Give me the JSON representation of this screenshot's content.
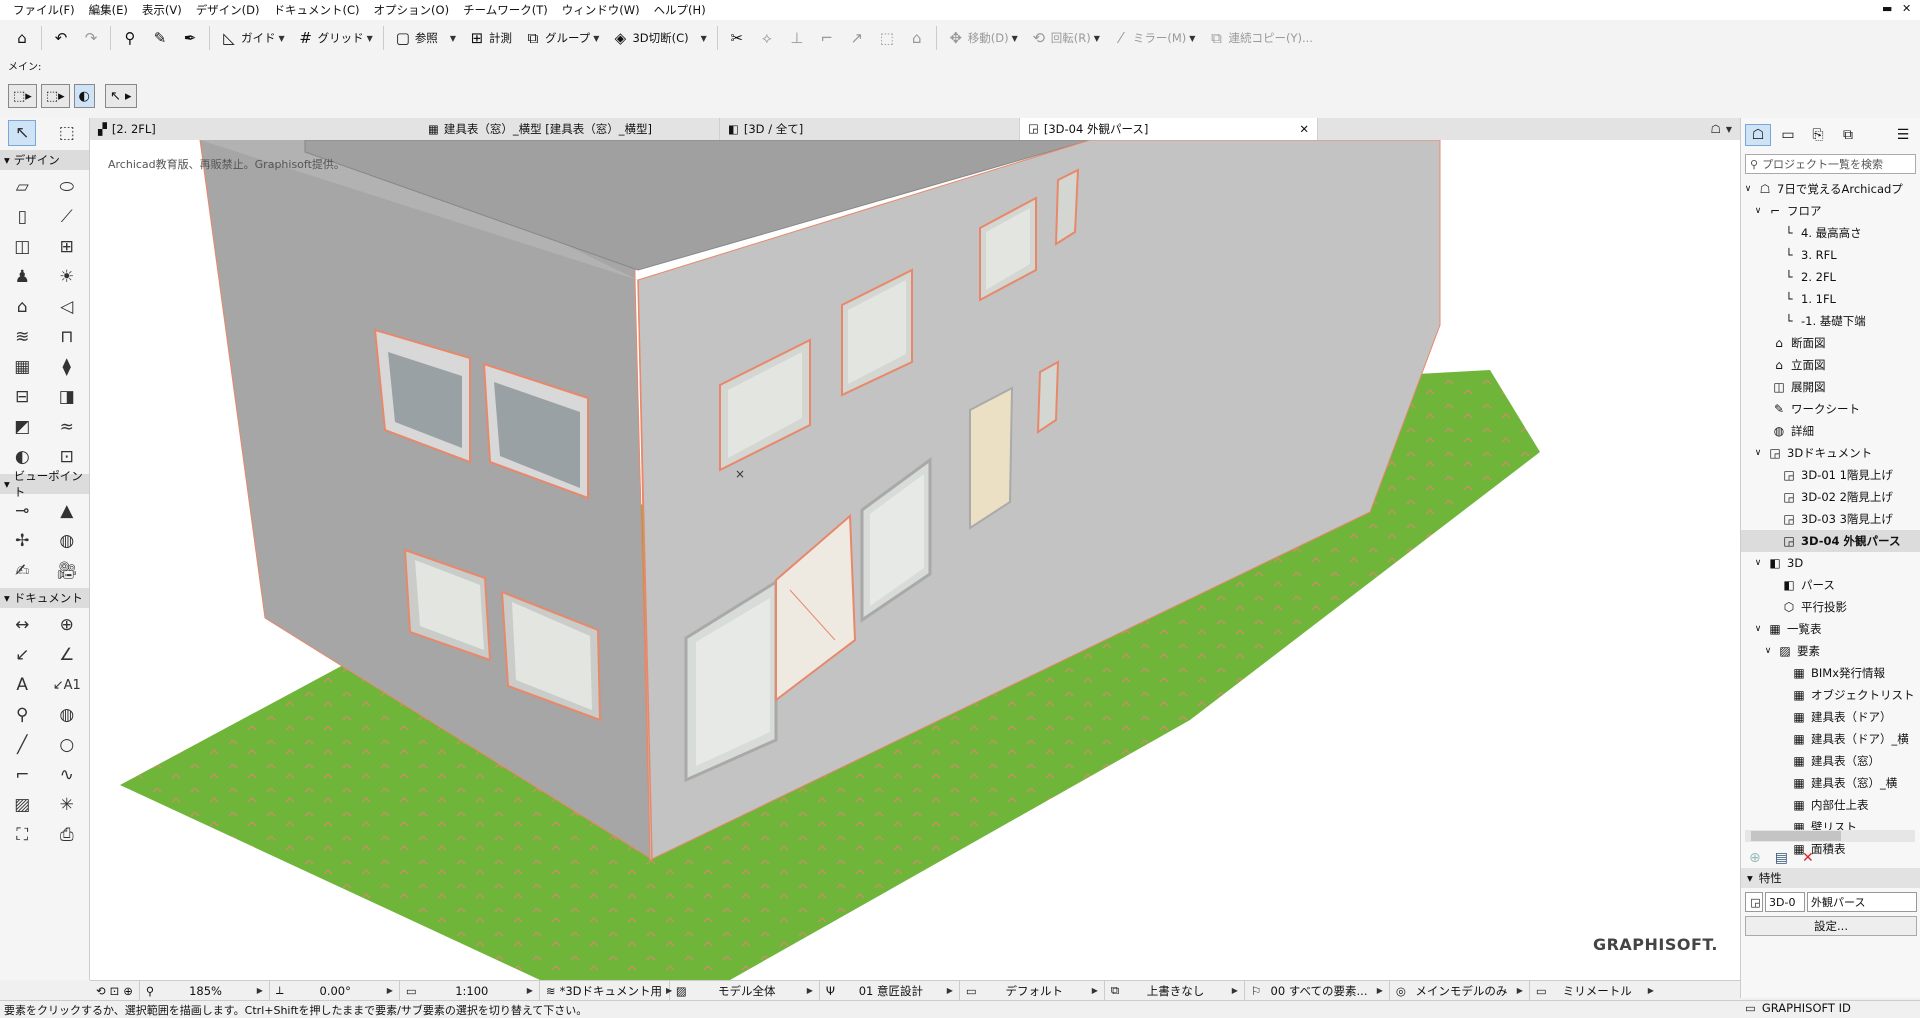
{
  "menu": [
    "ファイル(F)",
    "編集(E)",
    "表示(V)",
    "デザイン(D)",
    "ドキュメント(C)",
    "オプション(O)",
    "チームワーク(T)",
    "ウィンドウ(W)",
    "ヘルプ(H)"
  ],
  "toolbar": {
    "guide": "ガイド",
    "grid": "グリッド",
    "reference": "参照",
    "measure": "計測",
    "group": "グループ",
    "cut3d": "3D切断(C)",
    "move": "移動(D)",
    "rotate": "回転(R)",
    "mirror": "ミラー(M)",
    "multiply": "連続コピー(Y)..."
  },
  "sub": {
    "main_label": "メイン:"
  },
  "tabs": [
    {
      "label": "[2. 2FL]"
    },
    {
      "label": "建具表（窓）_横型 [建具表（窓）_横型]"
    },
    {
      "label": "[3D / 全て]"
    },
    {
      "label": "[3D-04 外観パース]"
    }
  ],
  "left": {
    "design": "デザイン",
    "viewpoint": "ビューポイント",
    "document": "ドキュメント"
  },
  "viewport": {
    "watermark": "Archicad教育版、再販禁止。Graphisoft提供。",
    "brand": "GRAPHISOFT."
  },
  "navigator": {
    "search_placeholder": "プロジェクト一覧を検索",
    "items": [
      {
        "label": "7日で覚えるArchicadプ",
        "icon": "project-icon"
      },
      {
        "label": "フロア",
        "icon": "folder-icon"
      },
      {
        "label": "4. 最高高さ",
        "icon": "story-icon"
      },
      {
        "label": "3. RFL",
        "icon": "story-icon"
      },
      {
        "label": "2. 2FL",
        "icon": "story-icon"
      },
      {
        "label": "1. 1FL",
        "icon": "story-icon"
      },
      {
        "label": "-1. 基礎下端",
        "icon": "story-icon"
      },
      {
        "label": "断面図",
        "icon": "section-icon"
      },
      {
        "label": "立面図",
        "icon": "elevation-icon"
      },
      {
        "label": "展開図",
        "icon": "interior-elevation-icon"
      },
      {
        "label": "ワークシート",
        "icon": "worksheet-icon"
      },
      {
        "label": "詳細",
        "icon": "detail-icon"
      },
      {
        "label": "3Dドキュメント",
        "icon": "3d-document-icon"
      },
      {
        "label": "3D-01 1階見上げ",
        "icon": "3d-document-icon"
      },
      {
        "label": "3D-02 2階見上げ",
        "icon": "3d-document-icon"
      },
      {
        "label": "3D-03 3階見上げ",
        "icon": "3d-document-icon"
      },
      {
        "label": "3D-04 外観パース",
        "icon": "3d-document-icon"
      },
      {
        "label": "3D",
        "icon": "3d-icon"
      },
      {
        "label": "パース",
        "icon": "perspective-icon"
      },
      {
        "label": "平行投影",
        "icon": "axonometry-icon"
      },
      {
        "label": "一覧表",
        "icon": "schedule-icon"
      },
      {
        "label": "要素",
        "icon": "elements-icon"
      },
      {
        "label": "BIMx発行情報",
        "icon": "schedule-icon"
      },
      {
        "label": "オブジェクトリスト",
        "icon": "schedule-icon"
      },
      {
        "label": "建具表（ドア）",
        "icon": "schedule-icon"
      },
      {
        "label": "建具表（ドア）_横",
        "icon": "schedule-icon"
      },
      {
        "label": "建具表（窓）",
        "icon": "schedule-icon"
      },
      {
        "label": "建具表（窓）_横",
        "icon": "schedule-icon"
      },
      {
        "label": "内部仕上表",
        "icon": "schedule-icon"
      },
      {
        "label": "壁リスト",
        "icon": "schedule-icon"
      },
      {
        "label": "面積表",
        "icon": "schedule-icon"
      }
    ]
  },
  "properties": {
    "title": "特性",
    "id_value": "3D-0",
    "name_value": "外観パース",
    "settings_button": "設定..."
  },
  "bottom": {
    "zoom": "185%",
    "angle": "0.00°",
    "scale": "1:100",
    "layer_combo": "*3Dドキュメント用",
    "model_view": "モデル全体",
    "pen_set": "01 意匠設計",
    "partial_structure": "デフォルト",
    "graphic_override": "上書きなし",
    "renovation": "00 すべての要素...",
    "model_filter": "メインモデルのみ",
    "dimension": "ミリメートル"
  },
  "status": {
    "message": "要素をクリックするか、選択範囲を描画します。Ctrl+Shiftを押したままで要素/サブ要素の選択を切り替えて下さい。",
    "graphisoft_id": "GRAPHISOFT ID"
  }
}
